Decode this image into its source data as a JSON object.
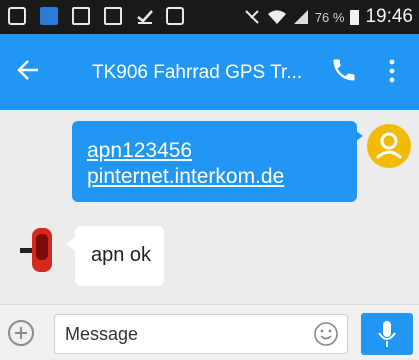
{
  "status_bar": {
    "time": "19:46",
    "battery_percent": "76 %",
    "notification_icons": [
      "p-icon",
      "app-icon",
      "image-icon",
      "gmail-icon",
      "download-icon",
      "message-icon"
    ]
  },
  "app_bar": {
    "title": "TK906 Fahrrad GPS Tr...",
    "back_icon": "arrow-back-icon",
    "call_icon": "phone-icon",
    "menu_icon": "more-vert-icon"
  },
  "messages": [
    {
      "direction": "outgoing",
      "lines": [
        "apn123456",
        "pinternet.interkom.de"
      ]
    },
    {
      "direction": "incoming",
      "text": "apn ok"
    }
  ],
  "composer": {
    "placeholder": "Message",
    "value": ""
  },
  "colors": {
    "primary": "#2196f3",
    "status_bar": "#1a1a1a",
    "avatar_me": "#f2bb05",
    "background": "#ececec"
  }
}
